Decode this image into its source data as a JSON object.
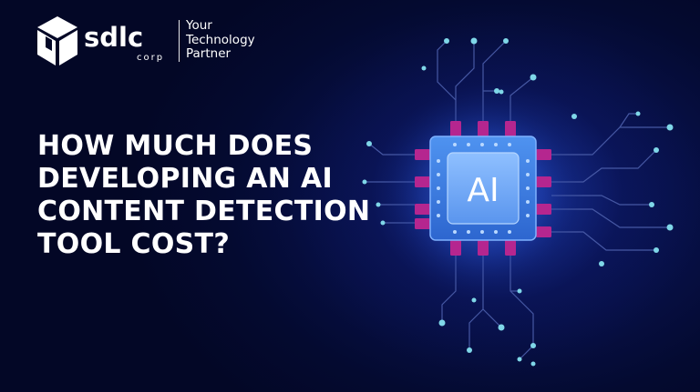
{
  "brand": {
    "name": "sdlc",
    "sub": "corp",
    "tagline": [
      "Your",
      "Technology",
      "Partner"
    ]
  },
  "headline": {
    "lines": [
      "HOW MUCH DOES",
      "DEVELOPING AN AI",
      "CONTENT DETECTION",
      "TOOL COST?"
    ]
  },
  "chip": {
    "label": "AI",
    "pin_color": "#b5268f",
    "body_color": "#3f82e6",
    "trace_color": "#4a5ca8",
    "node_color": "#7fd7e8"
  },
  "icons": [
    "logo-cube-icon",
    "ai-chip-icon"
  ]
}
